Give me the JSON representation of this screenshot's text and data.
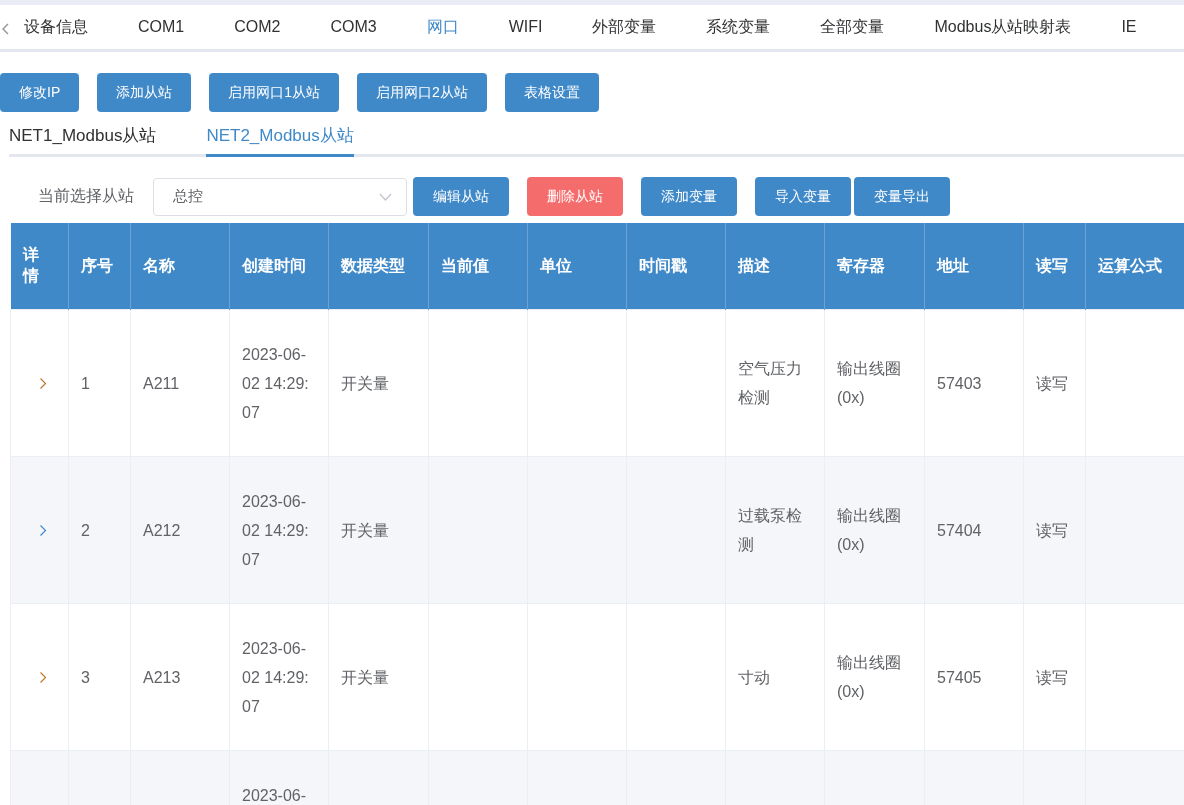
{
  "tabs": [
    {
      "label": "设备信息",
      "selected": false
    },
    {
      "label": "COM1",
      "selected": false
    },
    {
      "label": "COM2",
      "selected": false
    },
    {
      "label": "COM3",
      "selected": false
    },
    {
      "label": "网口",
      "selected": true
    },
    {
      "label": "WIFI",
      "selected": false
    },
    {
      "label": "外部变量",
      "selected": false
    },
    {
      "label": "系统变量",
      "selected": false
    },
    {
      "label": "全部变量",
      "selected": false
    },
    {
      "label": "Modbus从站映射表",
      "selected": false
    },
    {
      "label": "IE",
      "selected": false
    }
  ],
  "actions": [
    {
      "label": "修改IP"
    },
    {
      "label": "添加从站"
    },
    {
      "label": "启用网口1从站"
    },
    {
      "label": "启用网口2从站"
    },
    {
      "label": "表格设置"
    }
  ],
  "subtabs": [
    {
      "label": "NET1_Modbus从站",
      "selected": false
    },
    {
      "label": "NET2_Modbus从站",
      "selected": true
    }
  ],
  "slave_select": {
    "label": "当前选择从站",
    "value": "总控"
  },
  "slave_actions": [
    {
      "label": "编辑从站",
      "kind": "primary"
    },
    {
      "label": "删除从站",
      "kind": "danger"
    },
    {
      "label": "添加变量",
      "kind": "primary"
    },
    {
      "label": "导入变量",
      "kind": "primary"
    },
    {
      "label": "变量导出",
      "kind": "primary"
    }
  ],
  "table": {
    "columns": [
      "详情",
      "序号",
      "名称",
      "创建时间",
      "数据类型",
      "当前值",
      "单位",
      "时间戳",
      "描述",
      "寄存器",
      "地址",
      "读写",
      "运算公式"
    ],
    "rows": [
      {
        "expanded": false,
        "index": "1",
        "name": "A211",
        "created": "2023-06-02 14:29:07",
        "type": "开关量",
        "desc": "空气压力检测",
        "register": "输出线圈(0x)",
        "address": "57403",
        "rw": "读写"
      },
      {
        "expanded": false,
        "index": "2",
        "name": "A212",
        "created": "2023-06-02 14:29:07",
        "type": "开关量",
        "desc": "过载泵检测",
        "register": "输出线圈(0x)",
        "address": "57404",
        "rw": "读写"
      },
      {
        "expanded": false,
        "index": "3",
        "name": "A213",
        "created": "2023-06-02 14:29:07",
        "type": "开关量",
        "desc": "寸动",
        "register": "输出线圈(0x)",
        "address": "57405",
        "rw": "读写"
      },
      {
        "created": "2023-06-"
      }
    ]
  }
}
